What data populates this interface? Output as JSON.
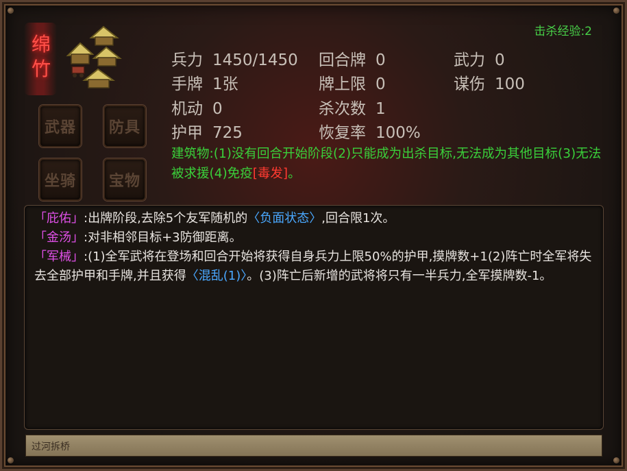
{
  "exp_label": "击杀经验:2",
  "general_name": "绵竹",
  "equipment_slots": [
    "武器",
    "防具",
    "坐骑",
    "宝物"
  ],
  "stats": [
    {
      "key": "兵力",
      "value": "1450/1450"
    },
    {
      "key": "回合牌",
      "value": "0"
    },
    {
      "key": "武力",
      "value": "0"
    },
    {
      "key": "手牌",
      "value": "1张"
    },
    {
      "key": "牌上限",
      "value": "0"
    },
    {
      "key": "谋伤",
      "value": "100"
    },
    {
      "key": "机动",
      "value": "0"
    },
    {
      "key": "杀次数",
      "value": "1"
    },
    {
      "key": "护甲",
      "value": "725"
    },
    {
      "key": "恢复率",
      "value": "100%"
    }
  ],
  "building": {
    "text": "建筑物:(1)没有回合开始阶段(2)只能成为出杀目标,无法成为其他目标(3)无法被求援(4)免疫",
    "poison": "[毒发]",
    "end": "。"
  },
  "skills": [
    {
      "name": "「庇佑」",
      "parts": [
        ":出牌阶段,去除5个友军随机的",
        "〈负面状态〉",
        ",回合限1次。"
      ]
    },
    {
      "name": "「金汤」",
      "parts": [
        ":对非相邻目标+3防御距离。"
      ]
    },
    {
      "name": "「军械」",
      "parts": [
        ":(1)全军武将在登场和回合开始将获得自身兵力上限50%的护甲,摸牌数+1(2)阵亡时全军将失去全部护甲和手牌,并且获得",
        "〈混乱(1)〉",
        "。(3)阵亡后新增的武将将只有一半兵力,全军摸牌数-1。"
      ]
    }
  ],
  "footer_text": "过河拆桥",
  "colors": {
    "exp": "#48d048",
    "name": "#ff5048",
    "building": "#3ad03a",
    "skill_name": "#e050e8",
    "keyword": "#4aa8ff"
  }
}
